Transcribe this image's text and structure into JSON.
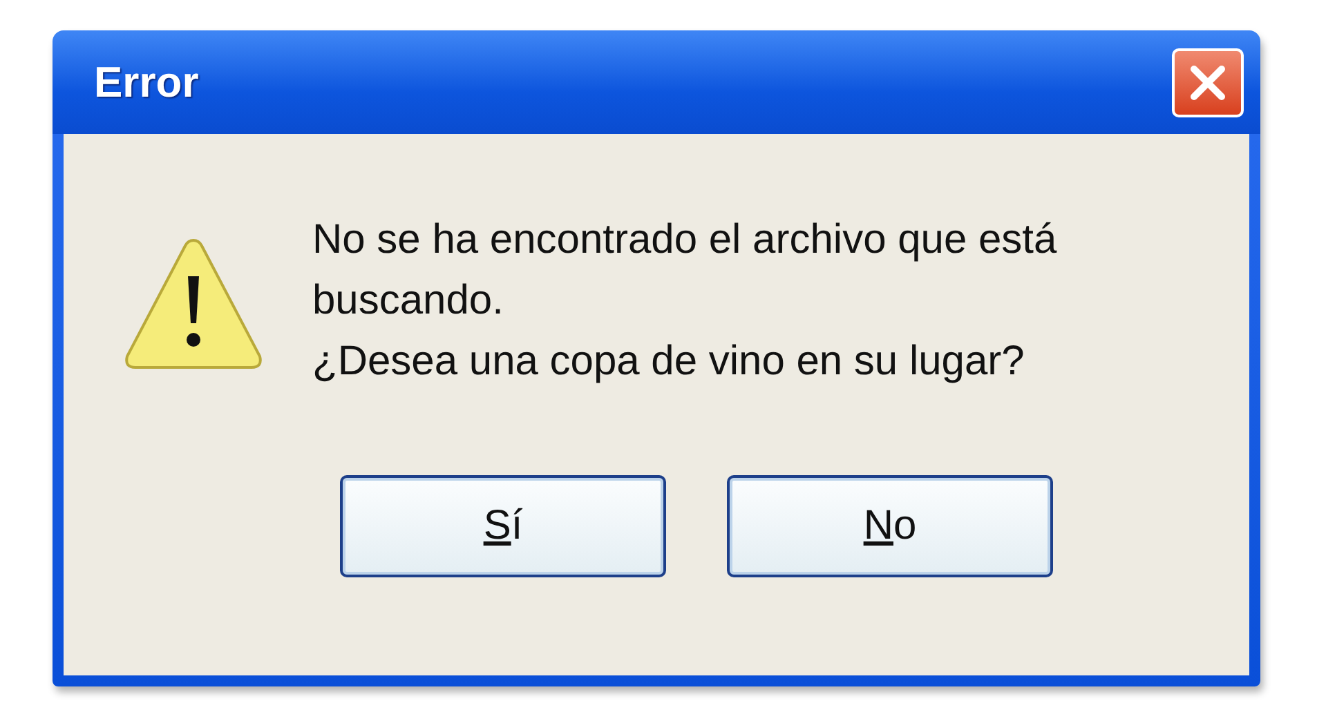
{
  "window": {
    "title": "Error"
  },
  "icon": {
    "kind": "warning"
  },
  "message": [
    "No se ha encontrado el archivo que está buscando.",
    "¿Desea una copa de vino en su lugar?"
  ],
  "buttons": [
    {
      "access_key": "S",
      "label_rest": "í"
    },
    {
      "access_key": "N",
      "label_rest": "o"
    }
  ]
}
